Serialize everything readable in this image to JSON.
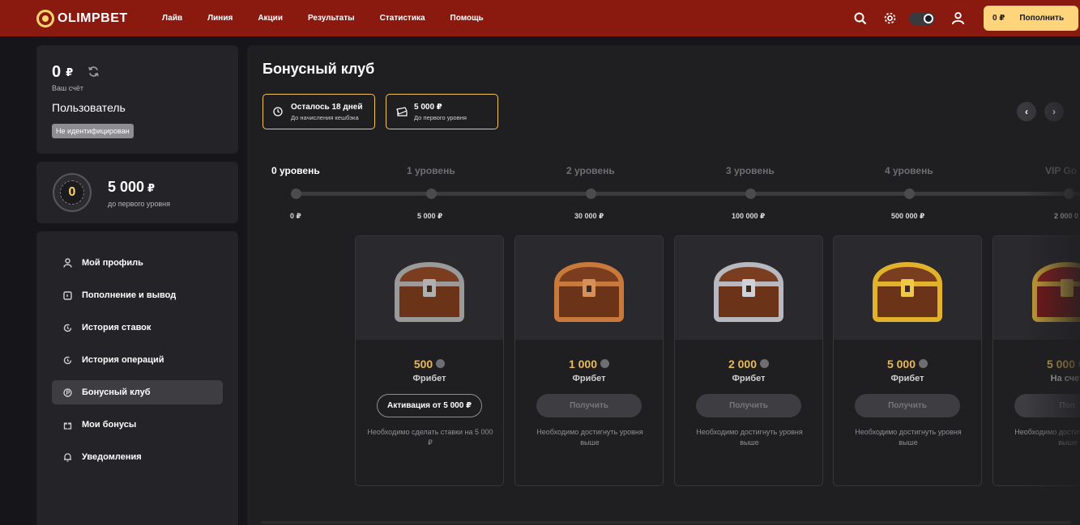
{
  "header": {
    "logo": "OLIMPBET",
    "nav": [
      "Лайв",
      "Линия",
      "Акции",
      "Результаты",
      "Статистика",
      "Помощь"
    ],
    "balance": "0 ₽",
    "topup_label": "Пополнить",
    "accent": "#8a1a10"
  },
  "account": {
    "balance": "0",
    "currency": "₽",
    "balance_label": "Ваш счёт",
    "user": "Пользователь",
    "badge": "Не идентифицирован"
  },
  "level_card": {
    "medal_level": "0",
    "amount": "5 000",
    "currency": "₽",
    "label": "до первого уровня"
  },
  "menu": [
    {
      "label": "Мой профиль",
      "icon": "user-icon"
    },
    {
      "label": "Пополнение и вывод",
      "icon": "wallet-icon"
    },
    {
      "label": "История ставок",
      "icon": "history-icon"
    },
    {
      "label": "История операций",
      "icon": "history-icon"
    },
    {
      "label": "Бонусный клуб",
      "icon": "coin-icon",
      "active": true
    },
    {
      "label": "Мои бонусы",
      "icon": "gift-icon"
    },
    {
      "label": "Уведомления",
      "icon": "bell-icon"
    }
  ],
  "bonus": {
    "title": "Бонусный клуб",
    "pill1": {
      "title": "Осталось 18 дней",
      "sub": "До начисления кешбэка"
    },
    "pill2": {
      "title": "5 000 ₽",
      "sub": "До первого уровня"
    },
    "levels": [
      {
        "name": "0 уровень",
        "threshold": "0 ₽"
      },
      {
        "name": "1 уровень",
        "threshold": "5 000 ₽"
      },
      {
        "name": "2 уровень",
        "threshold": "30 000 ₽"
      },
      {
        "name": "3 уровень",
        "threshold": "100 000 ₽"
      },
      {
        "name": "4 уровень",
        "threshold": "500 000 ₽"
      },
      {
        "name": "VIP Go",
        "threshold": "2 000 0"
      }
    ],
    "cards": [
      {
        "value": "500",
        "type": "Фрибет",
        "button": "Активация от 5 000 ₽",
        "note": "Необходимо сделать ставки на 5 000 ₽",
        "metal": "#9a9a9a"
      },
      {
        "value": "1 000",
        "type": "Фрибет",
        "button": "Получить",
        "note": "Необходимо достигнуть уровня выше",
        "metal": "#c97a3a"
      },
      {
        "value": "2 000",
        "type": "Фрибет",
        "button": "Получить",
        "note": "Необходимо достигнуть уровня выше",
        "metal": "#b8b8c0"
      },
      {
        "value": "5 000",
        "type": "Фрибет",
        "button": "Получить",
        "note": "Необходимо достигнуть уровня выше",
        "metal": "#e2b22a"
      },
      {
        "value": "5 000",
        "type": "На счет",
        "button": "Пол",
        "note": "Необходимо достигнуть уровня выше",
        "metal": "#c23a3a"
      }
    ]
  }
}
